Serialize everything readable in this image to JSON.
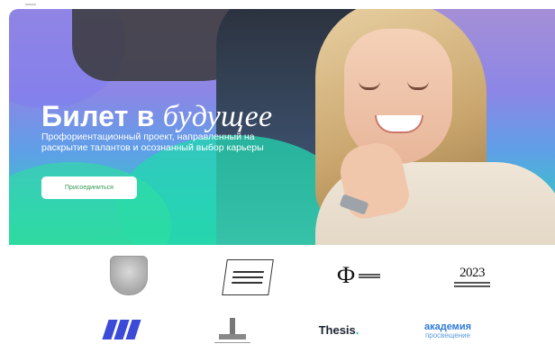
{
  "hero": {
    "title_regular": "Билет в ",
    "title_italic": "будущее",
    "subtitle": "Профориентационный проект, направленный на раскрытие талантов и осознанный выбор карьеры",
    "cta_label": "Присоединиться"
  },
  "partners": {
    "row2": {
      "thesis": "Thesis",
      "thesis_dot": ".",
      "akademia_line1": "академия",
      "akademia_line2": "просвещение"
    },
    "row1": {
      "year_logo": "2023"
    }
  }
}
